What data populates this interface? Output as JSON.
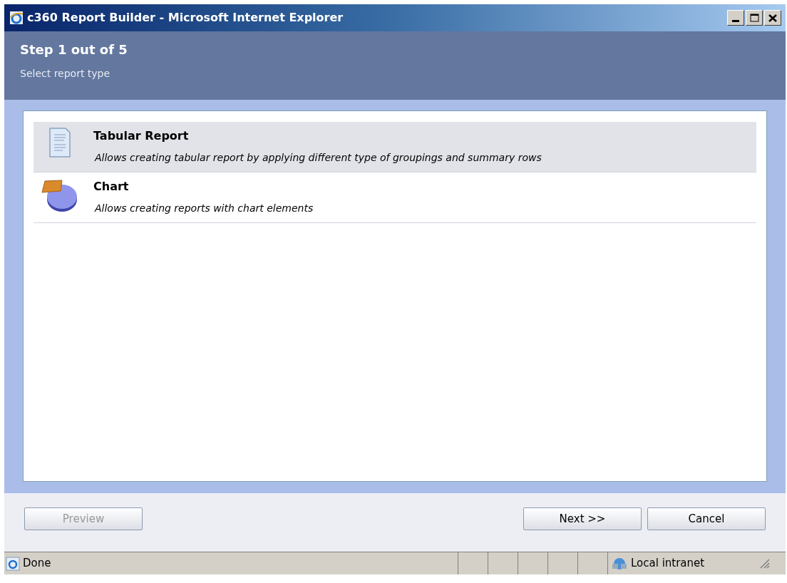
{
  "window": {
    "title": "c360 Report Builder - Microsoft Internet Explorer"
  },
  "header": {
    "step": "Step 1 out of 5",
    "subtitle": "Select report type"
  },
  "report_types": [
    {
      "kind": "document",
      "title": "Tabular Report",
      "description": "Allows creating tabular report by applying different type of groupings and summary rows",
      "selected": true
    },
    {
      "kind": "chart",
      "title": "Chart",
      "description": "Allows creating reports with chart elements",
      "selected": false
    }
  ],
  "buttons": [
    {
      "label": "Preview",
      "disabled": true
    },
    {
      "label": "Next >>",
      "disabled": false
    },
    {
      "label": "Cancel",
      "disabled": false
    }
  ],
  "status_bar": {
    "text": "Done",
    "zone": "Local intranet"
  }
}
